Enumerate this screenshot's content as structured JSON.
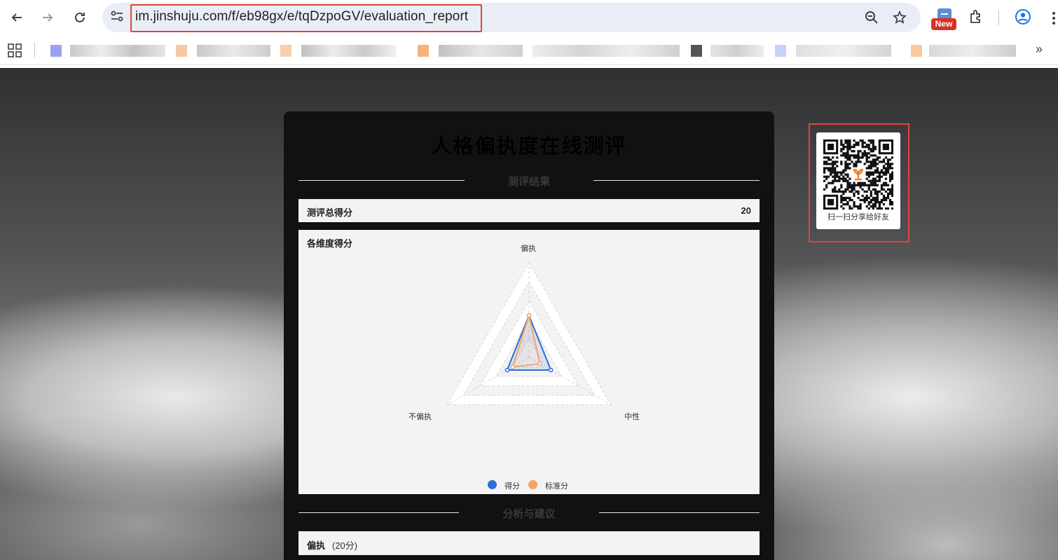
{
  "browser": {
    "url": "im.jinshuju.com/f/eb98gx/e/tqDzpoGV/evaluation_report",
    "new_badge": "New",
    "overflow": "»"
  },
  "report": {
    "title": "人格偏执度在线测评",
    "section_result": "测评结果",
    "total_label": "测评总得分",
    "total_value": "20",
    "dimension_label": "各维度得分",
    "section_analysis": "分析与建议",
    "analysis_item_name": "偏执",
    "analysis_item_score": "(20分)"
  },
  "share": {
    "caption": "扫一扫分享给好友"
  },
  "chart_data": {
    "type": "radar",
    "axes": [
      "偏执",
      "中性",
      "不偏执"
    ],
    "series": [
      {
        "name": "得分",
        "values": [
          20,
          12,
          12
        ],
        "color": "#2b6fd6"
      },
      {
        "name": "标准分",
        "values": [
          20,
          6,
          9
        ],
        "color": "#f5a26a"
      }
    ],
    "max": 45,
    "rings": 5,
    "legend_position": "bottom"
  }
}
